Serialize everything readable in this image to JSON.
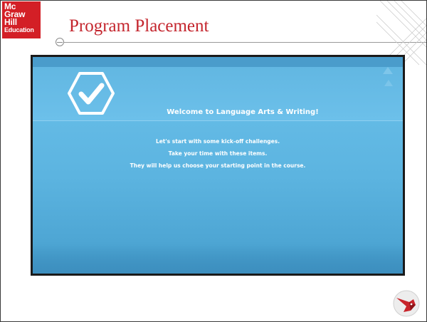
{
  "brand": {
    "line1": "Mc",
    "line2": "Graw",
    "line3": "Hill",
    "line4": "Education",
    "color": "#d31f26"
  },
  "slide": {
    "title": "Program Placement",
    "title_color": "#c4262e"
  },
  "video": {
    "icon": "checkmark-hexagon-icon",
    "welcome": "Welcome to Language Arts & Writing!",
    "lines": [
      "Let's start with some kick-off challenges.",
      "Take your time with these items.",
      "They will help us choose your starting point in the course."
    ],
    "background_color": "#5ab2df"
  },
  "footer": {
    "icon": "bird-logo-icon"
  }
}
